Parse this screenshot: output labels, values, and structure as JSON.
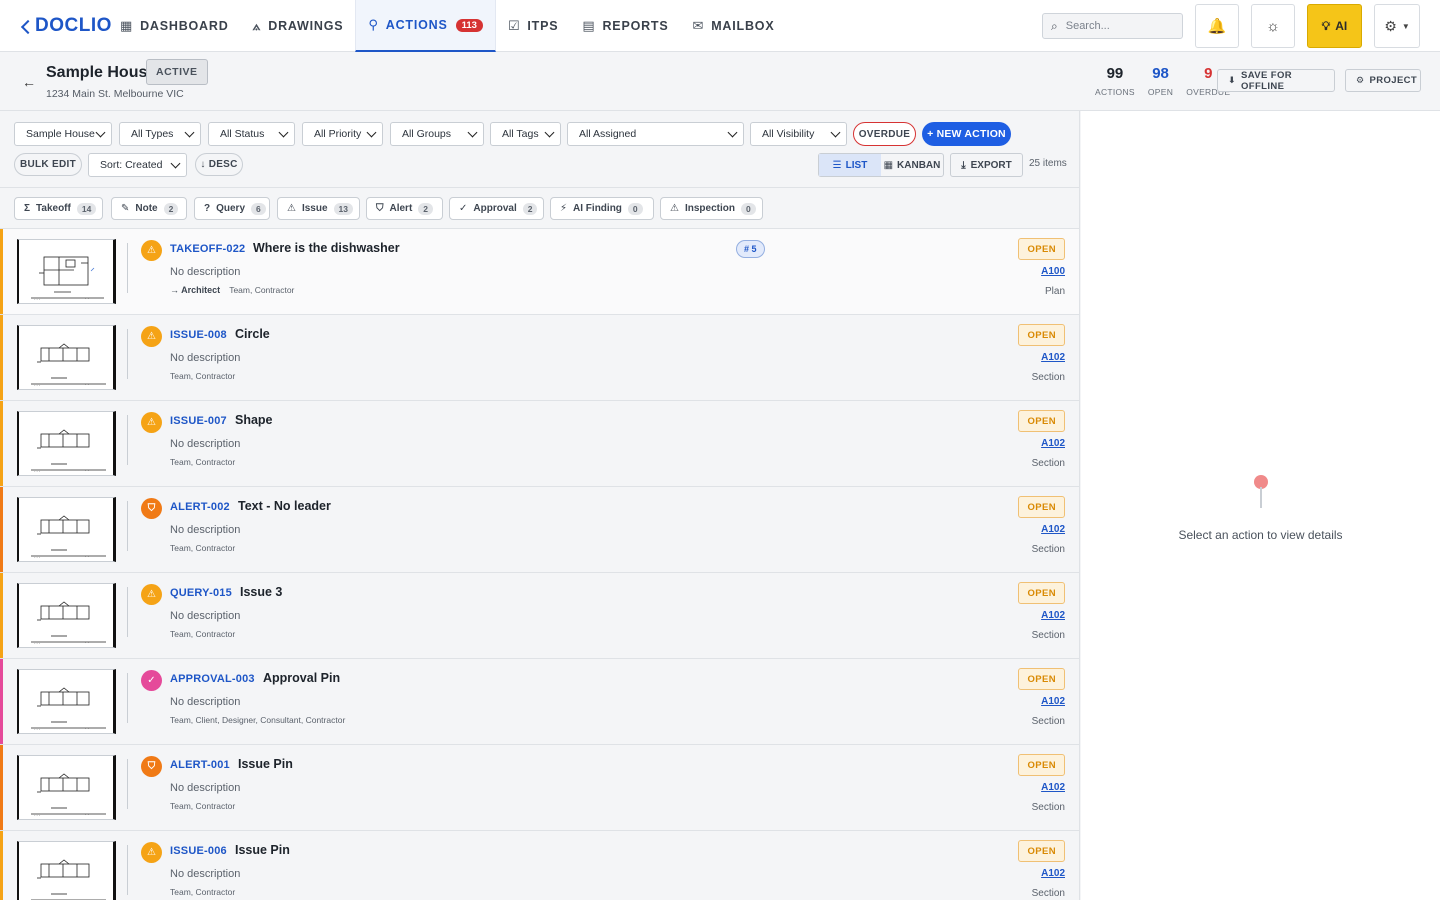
{
  "app": {
    "logo_text": "DOCLIO"
  },
  "nav": {
    "items": [
      {
        "label": "DASHBOARD",
        "icon": "grid-icon",
        "glyph": "▦"
      },
      {
        "label": "DRAWINGS",
        "icon": "compass-icon",
        "glyph": "⟑"
      },
      {
        "label": "ACTIONS",
        "icon": "pin-icon",
        "glyph": "⚲",
        "badge": "113",
        "active": true
      },
      {
        "label": "ITPS",
        "icon": "clipboard-check-icon",
        "glyph": "☑"
      },
      {
        "label": "REPORTS",
        "icon": "clipboard-icon",
        "glyph": "▤"
      },
      {
        "label": "MAILBOX",
        "icon": "inbox-icon",
        "glyph": "✉"
      }
    ]
  },
  "search": {
    "placeholder": "Search..."
  },
  "ai_button": {
    "label": "AI"
  },
  "project": {
    "name": "Sample House",
    "status": "ACTIVE",
    "address": "1234 Main St. Melbourne VIC",
    "stats": {
      "actions": "99",
      "actions_label": "ACTIONS",
      "open": "98",
      "open_label": "OPEN",
      "overdue": "9",
      "overdue_label": "OVERDUE"
    },
    "save_offline_label": "SAVE FOR OFFLINE",
    "project_label": "PROJECT"
  },
  "filters": {
    "project": "Sample House",
    "types": "All Types",
    "status": "All Status",
    "priority": "All Priority",
    "groups": "All Groups",
    "tags": "All Tags",
    "assigned": "All Assigned",
    "visibility": "All Visibility",
    "overdue_label": "OVERDUE",
    "new_action_label": "+ NEW ACTION",
    "bulk_edit_label": "BULK EDIT",
    "sort": "Sort: Created",
    "order_label": "↓ DESC",
    "list_label": "LIST",
    "kanban_label": "KANBAN",
    "export_label": "EXPORT",
    "item_count": "25 items"
  },
  "chips": [
    {
      "label": "Takeoff",
      "count": "14",
      "glyph": "Σ",
      "icon": "sigma-icon"
    },
    {
      "label": "Note",
      "count": "2",
      "glyph": "✎",
      "icon": "pencil-icon"
    },
    {
      "label": "Query",
      "count": "6",
      "glyph": "?",
      "icon": "question-icon"
    },
    {
      "label": "Issue",
      "count": "13",
      "glyph": "⚠",
      "icon": "warning-icon"
    },
    {
      "label": "Alert",
      "count": "2",
      "glyph": "⛉",
      "icon": "shield-icon"
    },
    {
      "label": "Approval",
      "count": "2",
      "glyph": "✓",
      "icon": "check-icon"
    },
    {
      "label": "AI Finding",
      "count": "0",
      "glyph": "⚡",
      "icon": "lightning-icon"
    },
    {
      "label": "Inspection",
      "count": "0",
      "glyph": "⚠",
      "icon": "warning-icon"
    }
  ],
  "actions": [
    {
      "id": "TAKEOFF-022",
      "title": "Where is the dishwasher",
      "description": "No description",
      "assignee": "→ Architect",
      "groups": "Team, Contractor",
      "count_badge": "# 5",
      "status": "OPEN",
      "sheet": "A100",
      "sheet_type": "Plan",
      "accent": "#f5a316",
      "icon_color": "#f5a316",
      "glyph": "⚠",
      "icon": "warning-icon"
    },
    {
      "id": "ISSUE-008",
      "title": "Circle",
      "description": "No description",
      "groups": "Team, Contractor",
      "status": "OPEN",
      "sheet": "A102",
      "sheet_type": "Section",
      "accent": "#f5a316",
      "icon_color": "#f5a316",
      "glyph": "⚠",
      "icon": "warning-icon"
    },
    {
      "id": "ISSUE-007",
      "title": "Shape",
      "description": "No description",
      "groups": "Team, Contractor",
      "status": "OPEN",
      "sheet": "A102",
      "sheet_type": "Section",
      "accent": "#f5a316",
      "icon_color": "#f5a316",
      "glyph": "⚠",
      "icon": "warning-icon"
    },
    {
      "id": "ALERT-002",
      "title": "Text - No leader",
      "description": "No description",
      "groups": "Team, Contractor",
      "status": "OPEN",
      "sheet": "A102",
      "sheet_type": "Section",
      "accent": "#f07a16",
      "icon_color": "#f07a16",
      "glyph": "⛉",
      "icon": "shield-icon"
    },
    {
      "id": "QUERY-015",
      "title": "Issue 3",
      "description": "No description",
      "groups": "Team, Contractor",
      "status": "OPEN",
      "sheet": "A102",
      "sheet_type": "Section",
      "accent": "#f5a316",
      "icon_color": "#f5a316",
      "glyph": "⚠",
      "icon": "warning-icon"
    },
    {
      "id": "APPROVAL-003",
      "title": "Approval Pin",
      "description": "No description",
      "groups": "Team, Client, Designer, Consultant, Contractor",
      "status": "OPEN",
      "sheet": "A102",
      "sheet_type": "Section",
      "accent": "#e54a9a",
      "icon_color": "#e54a9a",
      "glyph": "✓",
      "icon": "check-icon"
    },
    {
      "id": "ALERT-001",
      "title": "Issue Pin",
      "description": "No description",
      "groups": "Team, Contractor",
      "status": "OPEN",
      "sheet": "A102",
      "sheet_type": "Section",
      "accent": "#f07a16",
      "icon_color": "#f07a16",
      "glyph": "⛉",
      "icon": "shield-icon"
    },
    {
      "id": "ISSUE-006",
      "title": "Issue Pin",
      "description": "No description",
      "groups": "Team, Contractor",
      "status": "OPEN",
      "sheet": "A102",
      "sheet_type": "Section",
      "accent": "#f5a316",
      "icon_color": "#f5a316",
      "glyph": "⚠",
      "icon": "warning-icon"
    }
  ],
  "detail": {
    "empty_text": "Select an action to view details"
  }
}
